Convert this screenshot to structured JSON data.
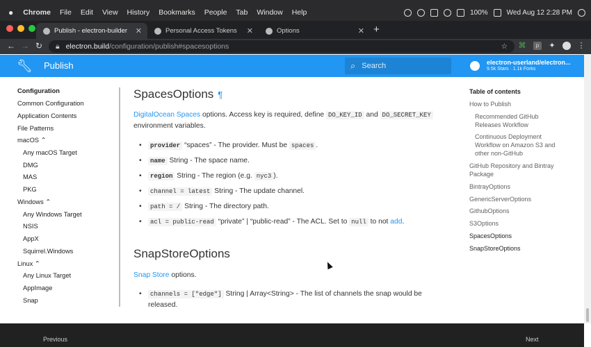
{
  "menubar": {
    "app": "Chrome",
    "menus": [
      "File",
      "Edit",
      "View",
      "History",
      "Bookmarks",
      "People",
      "Tab",
      "Window",
      "Help"
    ],
    "battery": "100%",
    "clock": "Wed Aug 12  2:28 PM"
  },
  "tabs": [
    {
      "title": "Publish - electron-builder",
      "active": true
    },
    {
      "title": "Personal Access Tokens",
      "active": false
    },
    {
      "title": "Options",
      "active": false
    }
  ],
  "toolbar": {
    "url_host": "electron.build",
    "url_path": "/configuration/publish#spacesoptions"
  },
  "header": {
    "title": "Publish",
    "search_placeholder": "Search",
    "repo_name": "electron-userland/electron...",
    "repo_stats": "9.5k Stars · 1.1k Forks"
  },
  "sidebar": {
    "items": [
      {
        "label": "Configuration",
        "level": 0,
        "head": true
      },
      {
        "label": "Common Configuration",
        "level": 0
      },
      {
        "label": "Application Contents",
        "level": 0
      },
      {
        "label": "File Patterns",
        "level": 0
      },
      {
        "label": "macOS ⌃",
        "level": 0
      },
      {
        "label": "Any macOS Target",
        "level": 1
      },
      {
        "label": "DMG",
        "level": 1
      },
      {
        "label": "MAS",
        "level": 1
      },
      {
        "label": "PKG",
        "level": 1
      },
      {
        "label": "Windows ⌃",
        "level": 0
      },
      {
        "label": "Any Windows Target",
        "level": 1
      },
      {
        "label": "NSIS",
        "level": 1
      },
      {
        "label": "AppX",
        "level": 1
      },
      {
        "label": "Squirrel.Windows",
        "level": 1
      },
      {
        "label": "Linux ⌃",
        "level": 0
      },
      {
        "label": "Any Linux Target",
        "level": 1
      },
      {
        "label": "AppImage",
        "level": 1
      },
      {
        "label": "Snap",
        "level": 1
      }
    ]
  },
  "content": {
    "spaces": {
      "heading": "SpacesOptions",
      "pilcrow": "¶",
      "intro_link": "DigitalOcean Spaces",
      "intro_text": " options. Access key is required, define ",
      "intro_code1": "DO_KEY_ID",
      "intro_and": " and ",
      "intro_code2": "DO_SECRET_KEY",
      "intro_tail": "environment variables.",
      "bullets": [
        {
          "code": "provider",
          "bold": true,
          "text": " “spaces” - The provider. Must be ",
          "code2": "spaces",
          "tail": "."
        },
        {
          "code": "name",
          "bold": true,
          "text": " String - The space name.",
          "code2": "",
          "tail": ""
        },
        {
          "code": "region",
          "bold": true,
          "text": " String - The region (e.g. ",
          "code2": "nyc3",
          "tail": ")."
        },
        {
          "code": "channel = latest",
          "bold": false,
          "text": " String - The update channel.",
          "code2": "",
          "tail": ""
        },
        {
          "code": "path = /",
          "bold": false,
          "text": " String - The directory path.",
          "code2": "",
          "tail": ""
        },
        {
          "code": "acl = public-read",
          "bold": false,
          "text": " “private” | “public-read” - The ACL. Set to ",
          "code2": "null",
          "tail": " to not ",
          "link": "add",
          "end": "."
        }
      ]
    },
    "snap": {
      "heading": "SnapStoreOptions",
      "intro_link": "Snap Store",
      "intro_text": " options.",
      "bullet_code": "channels = [\"edge\"]",
      "bullet_text": " String | Array<String> - The list of channels the snap would be",
      "bullet_text2": "released."
    }
  },
  "toc": {
    "title": "Table of contents",
    "items": [
      {
        "label": "How to Publish",
        "sub": false
      },
      {
        "label": "Recommended GitHub Releases Workflow",
        "sub": true
      },
      {
        "label": "Continuous Deployment Workflow on Amazon S3 and other non-GitHub",
        "sub": true
      },
      {
        "label": "GitHub Repository and Bintray Package",
        "sub": false
      },
      {
        "label": "BintrayOptions",
        "sub": false
      },
      {
        "label": "GenericServerOptions",
        "sub": false
      },
      {
        "label": "GithubOptions",
        "sub": false
      },
      {
        "label": "S3Options",
        "sub": false
      },
      {
        "label": "SpacesOptions",
        "sub": false,
        "active": true
      },
      {
        "label": "SnapStoreOptions",
        "sub": false,
        "active": true
      }
    ]
  },
  "footer": {
    "prev": "Previous",
    "next": "Next"
  },
  "colors": {
    "accent": "#2196f3",
    "header_bg": "#2196f3",
    "footer_bg": "#212121"
  }
}
